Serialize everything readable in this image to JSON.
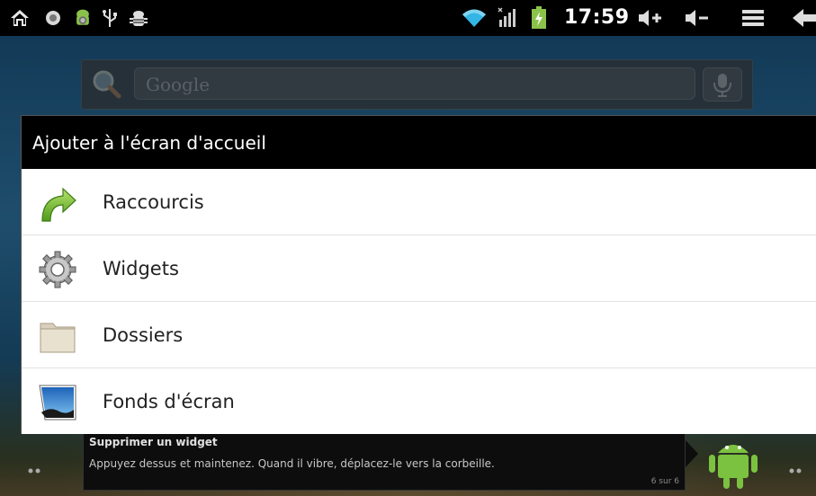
{
  "status_bar": {
    "time": "17:59",
    "icons": [
      "home-icon",
      "notification-dot-icon",
      "android-debug-icon",
      "usb-icon",
      "android-bug-icon",
      "wifi-icon",
      "signal-icon",
      "battery-charging-icon",
      "volume-up-icon",
      "volume-down-icon",
      "menu-icon",
      "back-icon"
    ]
  },
  "search": {
    "placeholder": "Google"
  },
  "dialog": {
    "title": "Ajouter à l'écran d'accueil",
    "items": [
      {
        "label": "Raccourcis",
        "icon": "shortcut-arrow-icon"
      },
      {
        "label": "Widgets",
        "icon": "gear-icon"
      },
      {
        "label": "Dossiers",
        "icon": "folder-icon"
      },
      {
        "label": "Fonds d'écran",
        "icon": "wallpaper-icon"
      }
    ]
  },
  "tip": {
    "title": "Supprimer un widget",
    "text": "Appuyez dessus et maintenez. Quand il vibre, déplacez-le vers la corbeille.",
    "count": "6 sur 6"
  },
  "colors": {
    "dialog_title_bg": "#000000",
    "accent_green": "#7cc241"
  }
}
